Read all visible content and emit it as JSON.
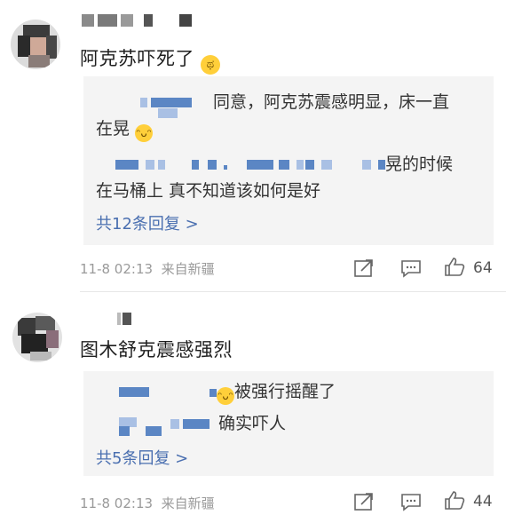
{
  "comments": [
    {
      "text": "阿克苏吓死了",
      "emoji_icon": "crying-face-emoji",
      "replies": [
        {
          "text": "同意，阿克苏震感明显，床一直",
          "cont": "在晃",
          "emoji_icon": "laughing-face-emoji"
        },
        {
          "text": "晃的时候",
          "cont": "在马桶上 真不知道该如何是好"
        }
      ],
      "more_label": "共12条回复 >",
      "time": "11-8 02:13",
      "source": "来自新疆",
      "likes": "64"
    },
    {
      "text": "图木舒克震感强烈",
      "replies": [
        {
          "text": "被强行摇醒了",
          "emoji_icon": "laughing-face-emoji"
        },
        {
          "text": "确实吓人"
        }
      ],
      "more_label": "共5条回复 >",
      "time": "11-8 02:13",
      "source": "来自新疆",
      "likes": "44"
    }
  ],
  "colors": {
    "link": "#4a6fb0",
    "reply_bg": "#f4f4f4",
    "mosaic_blue": "#5b86c4"
  }
}
